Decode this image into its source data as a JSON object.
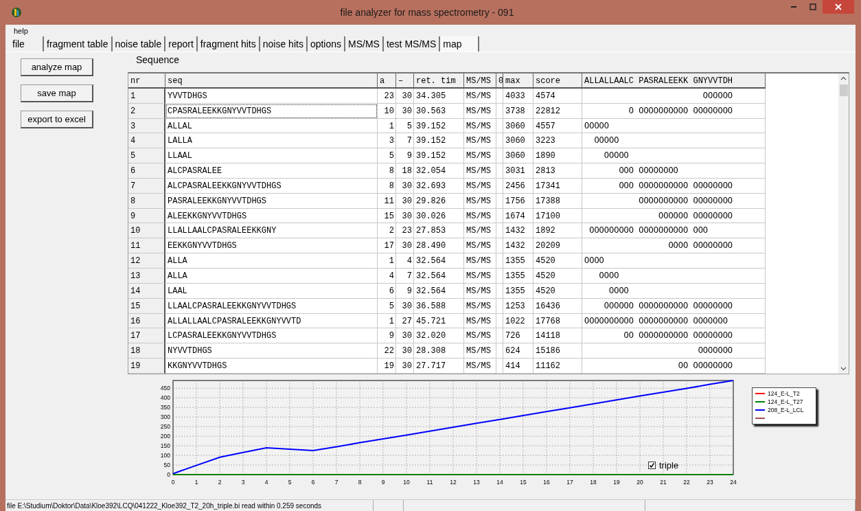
{
  "window": {
    "title": "file analyzer for mass spectrometry  - 091"
  },
  "menu": [
    {
      "label": "help"
    }
  ],
  "tabs": [
    {
      "label": "file",
      "selected": false
    },
    {
      "label": "fragment table",
      "selected": false
    },
    {
      "label": "noise table",
      "selected": false
    },
    {
      "label": "report",
      "selected": false
    },
    {
      "label": "fragment hits",
      "selected": false
    },
    {
      "label": "noise hits",
      "selected": false
    },
    {
      "label": "options",
      "selected": false
    },
    {
      "label": "MS/MS",
      "selected": false
    },
    {
      "label": "test MS/MS",
      "selected": false
    },
    {
      "label": "map",
      "selected": true
    }
  ],
  "buttons": [
    "analyze map",
    "save map",
    "export to excel"
  ],
  "sequence_label": "Sequence",
  "table": {
    "columns": [
      "nr",
      "seq",
      "a",
      "–",
      "ret. tim",
      "MS/MS",
      "0",
      "max",
      "score",
      "ALLALLAALC PASRALEEKK GNYVVTDH"
    ],
    "rows": [
      {
        "cells": [
          "1",
          "YVVTDHGS",
          "23",
          "30",
          "34.305",
          "MS/MS",
          "",
          "4033",
          "4574",
          "                        OOOOOO"
        ],
        "focused": false
      },
      {
        "cells": [
          "2",
          "CPASRALEEKKGNYVVTDHGS",
          "10",
          "30",
          "30.563",
          "MS/MS",
          "",
          "3738",
          "22812",
          "         O OOOOOOOOOO OOOOOOOO"
        ],
        "focused": true
      },
      {
        "cells": [
          "3",
          "ALLAL",
          "1",
          "5",
          "39.152",
          "MS/MS",
          "",
          "3060",
          "4557",
          "OOOOO"
        ],
        "focused": false
      },
      {
        "cells": [
          "4",
          "LALLA",
          "3",
          "7",
          "39.152",
          "MS/MS",
          "",
          "3060",
          "3223",
          "  OOOOO"
        ],
        "focused": false
      },
      {
        "cells": [
          "5",
          "LLAAL",
          "5",
          "9",
          "39.152",
          "MS/MS",
          "",
          "3060",
          "1890",
          "    OOOOO"
        ],
        "focused": false
      },
      {
        "cells": [
          "6",
          "ALCPASRALEE",
          "8",
          "18",
          "32.054",
          "MS/MS",
          "",
          "3031",
          "2813",
          "       OOO OOOOOOOO"
        ],
        "focused": false
      },
      {
        "cells": [
          "7",
          "ALCPASRALEEKKGNYVVTDHGS",
          "8",
          "30",
          "32.693",
          "MS/MS",
          "",
          "2456",
          "17341",
          "       OOO OOOOOOOOOO OOOOOOOO"
        ],
        "focused": false
      },
      {
        "cells": [
          "8",
          "PASRALEEKKGNYVVTDHGS",
          "11",
          "30",
          "29.826",
          "MS/MS",
          "",
          "1756",
          "17388",
          "           OOOOOOOOOO OOOOOOOO"
        ],
        "focused": false
      },
      {
        "cells": [
          "9",
          "ALEEKKGNYVVTDHGS",
          "15",
          "30",
          "30.026",
          "MS/MS",
          "",
          "1674",
          "17100",
          "               OOOOOO OOOOOOOO"
        ],
        "focused": false
      },
      {
        "cells": [
          "10",
          "LLALLAALCPASRALEEKKGNY",
          "2",
          "23",
          "27.853",
          "MS/MS",
          "",
          "1432",
          "1892",
          " OOOOOOOOO OOOOOOOOOO OOO"
        ],
        "focused": false
      },
      {
        "cells": [
          "11",
          "EEKKGNYVVTDHGS",
          "17",
          "30",
          "28.490",
          "MS/MS",
          "",
          "1432",
          "20209",
          "                 OOOO OOOOOOOO"
        ],
        "focused": false
      },
      {
        "cells": [
          "12",
          "ALLA",
          "1",
          "4",
          "32.564",
          "MS/MS",
          "",
          "1355",
          "4520",
          "OOOO"
        ],
        "focused": false
      },
      {
        "cells": [
          "13",
          "ALLA",
          "4",
          "7",
          "32.564",
          "MS/MS",
          "",
          "1355",
          "4520",
          "   OOOO"
        ],
        "focused": false
      },
      {
        "cells": [
          "14",
          "LAAL",
          "6",
          "9",
          "32.564",
          "MS/MS",
          "",
          "1355",
          "4520",
          "     OOOO"
        ],
        "focused": false
      },
      {
        "cells": [
          "15",
          "LLAALCPASRALEEKKGNYVVTDHGS",
          "5",
          "30",
          "36.588",
          "MS/MS",
          "",
          "1253",
          "16436",
          "    OOOOOO OOOOOOOOOO OOOOOOOO"
        ],
        "focused": false
      },
      {
        "cells": [
          "16",
          "ALLALLAALCPASRALEEKKGNYVVTD",
          "1",
          "27",
          "45.721",
          "MS/MS",
          "",
          "1022",
          "17768",
          "OOOOOOOOOO OOOOOOOOOO OOOOOOO"
        ],
        "focused": false
      },
      {
        "cells": [
          "17",
          "LCPASRALEEKKGNYVVTDHGS",
          "9",
          "30",
          "32.020",
          "MS/MS",
          "",
          "726",
          "14118",
          "        OO OOOOOOOOOO OOOOOOOO"
        ],
        "focused": false
      },
      {
        "cells": [
          "18",
          "NYVVTDHGS",
          "22",
          "30",
          "28.308",
          "MS/MS",
          "",
          "624",
          "15186",
          "                       OOOOOOO"
        ],
        "focused": false
      },
      {
        "cells": [
          "19",
          "KKGNYVVTDHGS",
          "19",
          "30",
          "27.717",
          "MS/MS",
          "",
          "414",
          "11162",
          "                   OO OOOOOOOO"
        ],
        "focused": false
      }
    ]
  },
  "chart": {
    "chart_data": {
      "type": "line",
      "x": [
        0,
        1,
        2,
        3,
        4,
        5,
        6,
        7,
        8,
        9,
        10,
        11,
        12,
        13,
        14,
        15,
        16,
        17,
        18,
        19,
        20,
        21,
        22,
        23,
        24
      ],
      "xlim": [
        0,
        24
      ],
      "ylim": [
        0,
        490
      ],
      "grid": true,
      "xticks": [
        0,
        1,
        2,
        3,
        4,
        5,
        6,
        7,
        8,
        9,
        10,
        11,
        12,
        13,
        14,
        15,
        16,
        17,
        18,
        19,
        20,
        21,
        22,
        23,
        24
      ],
      "yticks": [
        0,
        50,
        100,
        150,
        200,
        250,
        300,
        350,
        400,
        450
      ],
      "series": [
        {
          "name": "124_E-L_T2",
          "color": "#ff0000",
          "values": [
            null,
            null,
            null,
            null,
            null,
            null,
            null,
            null,
            null,
            null,
            null,
            null,
            null,
            null,
            null,
            null,
            null,
            null,
            null,
            null,
            null,
            null,
            null,
            null,
            null
          ]
        },
        {
          "name": "124_E-L_T27",
          "color": "#008000",
          "values": [
            0,
            0,
            0,
            0,
            0,
            0,
            0,
            0,
            0,
            0,
            0,
            0,
            0,
            0,
            0,
            0,
            0,
            0,
            0,
            0,
            0,
            0,
            0,
            0,
            0
          ]
        },
        {
          "name": "208_E-L_LCL",
          "color": "#0000ff",
          "values": [
            5,
            48,
            90,
            115,
            140,
            132,
            125,
            145,
            166,
            186,
            206,
            226,
            247,
            267,
            287,
            308,
            328,
            348,
            368,
            389,
            409,
            429,
            449,
            470,
            490
          ]
        },
        {
          "color": "#a05050",
          "values": [
            null,
            null,
            null,
            null,
            null,
            null,
            null,
            null,
            null,
            null,
            null,
            null,
            null,
            null,
            null,
            null,
            null,
            null,
            null,
            null,
            null,
            null,
            null,
            null,
            null
          ]
        }
      ]
    },
    "checkbox": {
      "label": "triple",
      "checked": true
    }
  },
  "status_bar": "file E:\\Studium\\Doktor\\Data\\Kloe392\\LCQ\\041222_Kloe392_T2_20h_triple.bi read within 0.259 seconds"
}
